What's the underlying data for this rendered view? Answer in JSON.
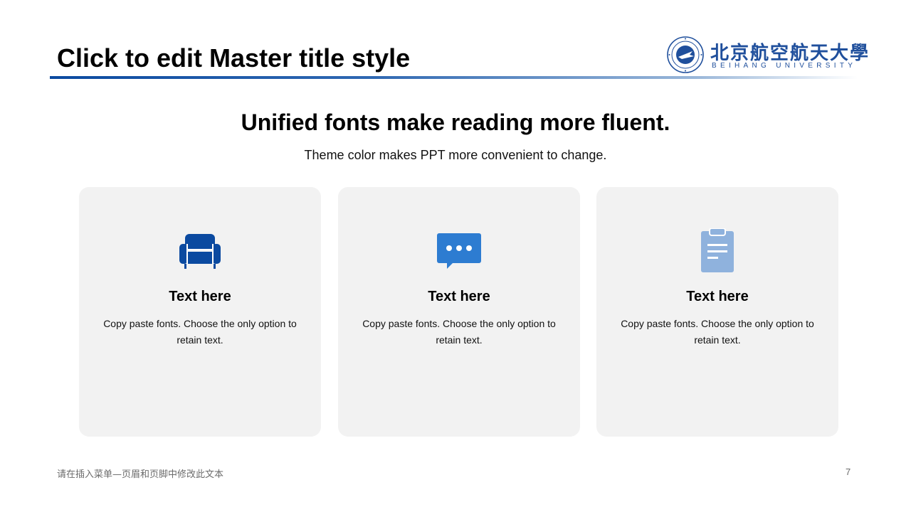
{
  "slide": {
    "title": "Click to edit Master title style",
    "heading": "Unified fonts make reading more fluent.",
    "subheading": "Theme color makes PPT more convenient to change."
  },
  "logo": {
    "name_cn": "北京航空航天大學",
    "name_en": "BEIHANG UNIVERSITY"
  },
  "cards": [
    {
      "icon": "sofa-icon",
      "icon_color": "#0b4aa0",
      "title": "Text here",
      "text": "Copy paste fonts. Choose the only option to retain text."
    },
    {
      "icon": "chat-bubble-icon",
      "icon_color": "#2d7cd1",
      "title": "Text here",
      "text": "Copy paste fonts. Choose the only option to retain text."
    },
    {
      "icon": "clipboard-icon",
      "icon_color": "#8fb2dd",
      "title": "Text here",
      "text": "Copy paste fonts. Choose the only option to retain text."
    }
  ],
  "footer": {
    "note": "请在插入菜单—页眉和页脚中修改此文本",
    "page_number": "7"
  },
  "colors": {
    "accent": "#0b4aa0",
    "card_background": "#f2f2f2"
  }
}
